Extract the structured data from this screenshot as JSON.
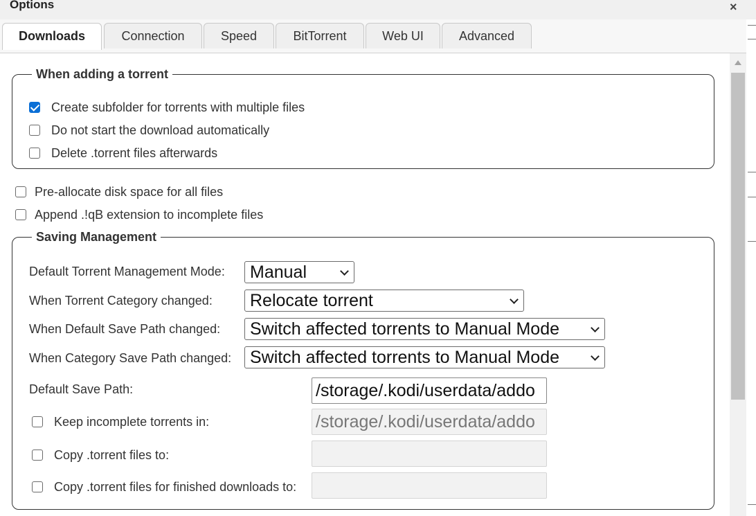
{
  "window": {
    "title": "Options",
    "close_glyph": "×"
  },
  "tabs": [
    {
      "label": "Downloads",
      "active": true
    },
    {
      "label": "Connection"
    },
    {
      "label": "Speed"
    },
    {
      "label": "BitTorrent"
    },
    {
      "label": "Web UI"
    },
    {
      "label": "Advanced"
    }
  ],
  "adding": {
    "legend": "When adding a torrent",
    "create_subfolder": {
      "label": "Create subfolder for torrents with multiple files",
      "checked": true
    },
    "no_autostart": {
      "label": "Do not start the download automatically",
      "checked": false
    },
    "delete_torrent": {
      "label": "Delete .torrent files afterwards",
      "checked": false
    }
  },
  "preallocate": {
    "label": "Pre-allocate disk space for all files",
    "checked": false
  },
  "append_ext": {
    "label": "Append .!qB extension to incomplete files",
    "checked": false
  },
  "saving": {
    "legend": "Saving Management",
    "mode": {
      "label": "Default Torrent Management Mode:",
      "value": "Manual"
    },
    "category_changed": {
      "label": "When Torrent Category changed:",
      "value": "Relocate torrent"
    },
    "default_path_changed": {
      "label": "When Default Save Path changed:",
      "value": "Switch affected torrents to Manual Mode"
    },
    "category_path_changed": {
      "label": "When Category Save Path changed:",
      "value": "Switch affected torrents to Manual Mode"
    },
    "default_save_path": {
      "label": "Default Save Path:",
      "value": "/storage/.kodi/userdata/addo"
    },
    "keep_incomplete": {
      "label": "Keep incomplete torrents in:",
      "checked": false,
      "value": "/storage/.kodi/userdata/addo"
    },
    "copy_torrent": {
      "label": "Copy .torrent files to:",
      "checked": false,
      "value": ""
    },
    "copy_finished": {
      "label": "Copy .torrent files for finished downloads to:",
      "checked": false,
      "value": ""
    }
  },
  "colors": {
    "accent": "#0b6fd6",
    "border": "#333333",
    "thumb": "#c1c1c1"
  },
  "icons": {
    "close": "close-icon",
    "scroll_up": "scroll-up-arrow-icon",
    "dropdown": "chevron-down-icon",
    "checkbox_checked": "checkmark-icon"
  }
}
